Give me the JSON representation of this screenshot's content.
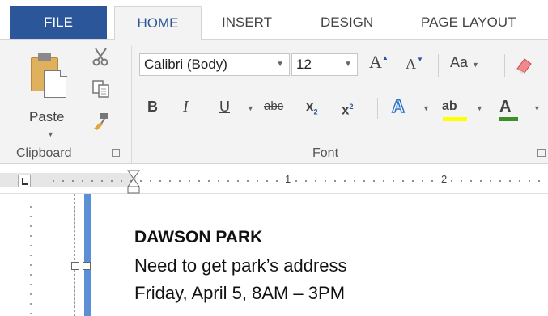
{
  "tabs": {
    "file": "FILE",
    "home": "HOME",
    "insert": "INSERT",
    "design": "DESIGN",
    "page_layout": "PAGE LAYOUT"
  },
  "clipboard": {
    "paste_label": "Paste",
    "group_label": "Clipboard",
    "icons": [
      "paste-icon",
      "cut-icon",
      "copy-icon",
      "format-painter-icon"
    ]
  },
  "font": {
    "group_label": "Font",
    "font_name": "Calibri (Body)",
    "font_size": "12",
    "grow_label": "A",
    "shrink_label": "A",
    "case_label": "Aa",
    "bold_label": "B",
    "italic_label": "I",
    "underline_label": "U",
    "strike_label": "abc",
    "subscript_label": "x",
    "subscript_mark": "2",
    "superscript_label": "x",
    "superscript_mark": "2",
    "effects_label": "A",
    "highlight_label": "ab",
    "color_label": "A",
    "colors": {
      "highlight": "#ffff00",
      "font_color": "#3d8f2a",
      "accent": "#2b579a"
    }
  },
  "ruler": {
    "mark_1": "1",
    "mark_2": "2"
  },
  "document": {
    "line1": "DAWSON PARK",
    "line2": "Need to get park’s address",
    "line3": "Friday, April 5, 8AM – 3PM"
  }
}
